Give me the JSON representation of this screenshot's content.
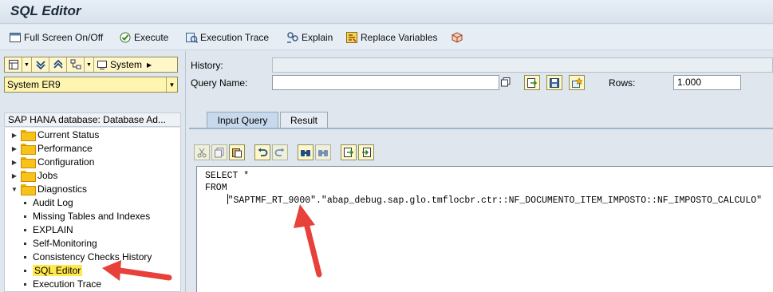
{
  "window": {
    "title": "SQL Editor"
  },
  "toolbar": {
    "full_screen": "Full Screen On/Off",
    "execute": "Execute",
    "execution_trace": "Execution Trace",
    "explain": "Explain",
    "replace_variables": "Replace Variables"
  },
  "left": {
    "system_button": "System",
    "system_select": "System ER9",
    "tree_header": "SAP HANA database: Database Ad...",
    "tree": [
      {
        "label": "Current Status",
        "kind": "folder",
        "expanded": false
      },
      {
        "label": "Performance",
        "kind": "folder",
        "expanded": false
      },
      {
        "label": "Configuration",
        "kind": "folder",
        "expanded": false
      },
      {
        "label": "Jobs",
        "kind": "folder",
        "expanded": false
      },
      {
        "label": "Diagnostics",
        "kind": "folder",
        "expanded": true
      },
      {
        "label": "Audit Log",
        "kind": "leaf"
      },
      {
        "label": "Missing Tables and Indexes",
        "kind": "leaf"
      },
      {
        "label": "EXPLAIN",
        "kind": "leaf"
      },
      {
        "label": "Self-Monitoring",
        "kind": "leaf"
      },
      {
        "label": "Consistency Checks History",
        "kind": "leaf"
      },
      {
        "label": "SQL Editor",
        "kind": "leaf",
        "selected": true
      },
      {
        "label": "Execution Trace",
        "kind": "leaf"
      }
    ]
  },
  "query": {
    "history_label": "History:",
    "history_value": "",
    "name_label": "Query Name:",
    "name_value": "",
    "rows_label": "Rows:",
    "rows_value": "1.000"
  },
  "tabs": {
    "input_query": "Input Query",
    "result": "Result",
    "active": "Input Query"
  },
  "editor": {
    "line1": "SELECT *",
    "line2": "FROM",
    "line3": "\"SAPTMF_RT_9000\".\"abap_debug.sap.glo.tmflocbr.ctr::NF_DOCUMENTO_ITEM_IMPOSTO::NF_IMPOSTO_CALCULO\""
  },
  "colors": {
    "accent_arrow": "#e8403a",
    "selection": "#ffe94d",
    "tab_active": "#c7d9ec"
  }
}
